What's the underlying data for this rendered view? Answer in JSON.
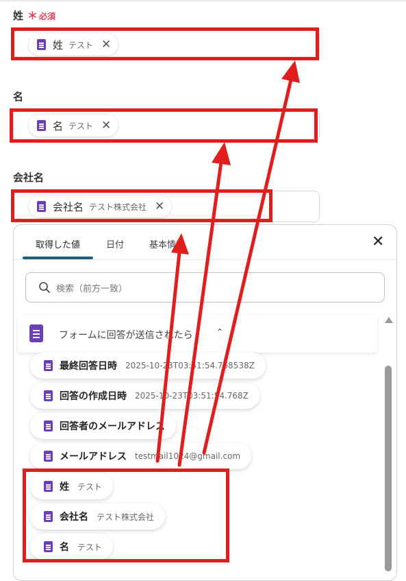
{
  "fields": [
    {
      "label": "姓",
      "required_mark": "＊",
      "required_text": "必須",
      "tag_name": "姓",
      "tag_value": "テスト",
      "remove_icon": "close-icon"
    },
    {
      "label": "名",
      "tag_name": "名",
      "tag_value": "テスト",
      "remove_icon": "close-icon"
    },
    {
      "label": "会社名",
      "tag_name": "会社名",
      "tag_value": "テスト株式会社",
      "remove_icon": "close-icon"
    }
  ],
  "panel": {
    "tabs": [
      {
        "label": "取得した値"
      },
      {
        "label": "日付"
      },
      {
        "label": "基本情報"
      }
    ],
    "close_label": "✕",
    "search_placeholder": "検索（前方一致）",
    "section_label": "フォームに回答が送信されたら",
    "section_chevron": "⌃",
    "items": [
      {
        "name": "最終回答日時",
        "value": "2025-10-23T03:51:54.768538Z"
      },
      {
        "name": "回答の作成日時",
        "value": "2025-10-23T03:51:54.768Z"
      },
      {
        "name": "回答者のメールアドレス",
        "value": ""
      },
      {
        "name": "メールアドレス",
        "value": "testmail1024@gmail.com"
      },
      {
        "name": "姓",
        "value": "テスト"
      },
      {
        "name": "会社名",
        "value": "テスト株式会社"
      },
      {
        "name": "名",
        "value": "テスト"
      }
    ]
  },
  "colors": {
    "annotation": "#e01e1e",
    "form_icon": "#6b3fb5",
    "required": "#e0405e",
    "active_tab": "#1f5f7e"
  }
}
